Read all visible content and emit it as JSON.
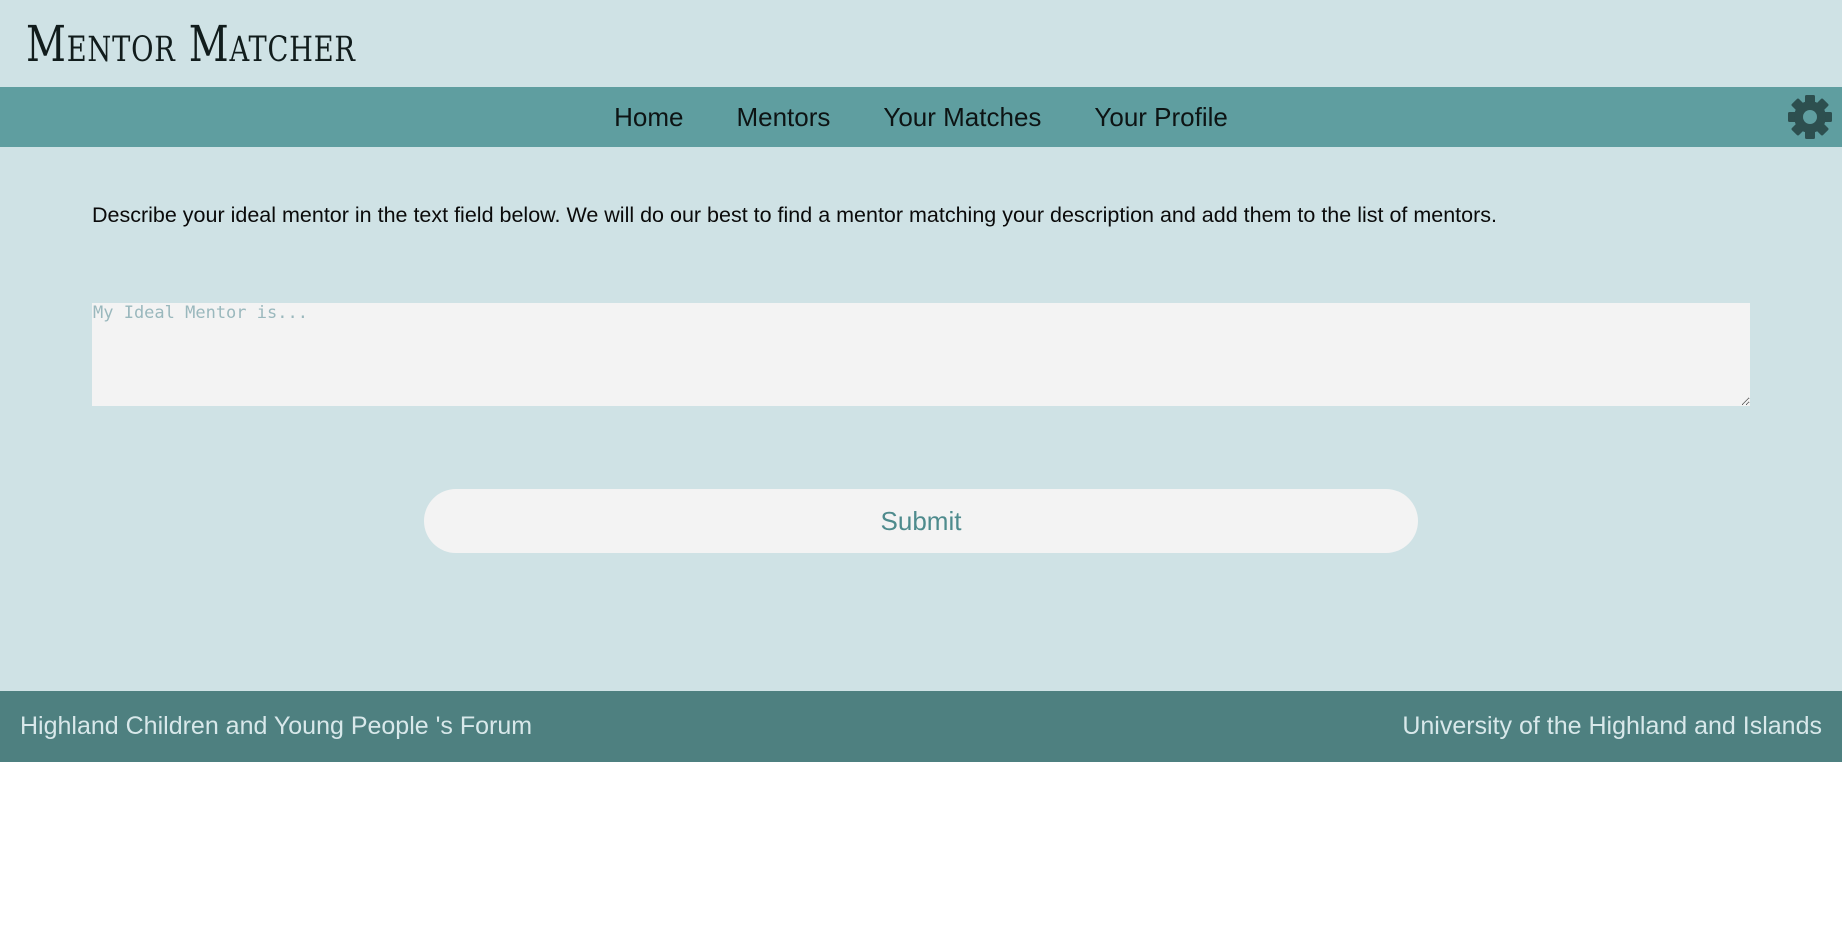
{
  "app": {
    "title": "Mentor Matcher"
  },
  "nav": {
    "items": [
      {
        "label": "Home"
      },
      {
        "label": "Mentors"
      },
      {
        "label": "Your Matches"
      },
      {
        "label": "Your Profile"
      }
    ],
    "settings_icon": "gear-icon"
  },
  "main": {
    "intro": "Describe your ideal mentor in the text field below. We will do our best to find a mentor matching your description and add them to the list of mentors.",
    "input": {
      "placeholder": "My Ideal Mentor is...",
      "value": ""
    },
    "submit_label": "Submit"
  },
  "footer": {
    "left": "Highland Children and Young People 's Forum",
    "right": "University of the Highland and Islands"
  },
  "colors": {
    "page_bg": "#cfe2e5",
    "nav_bg": "#5f9ea0",
    "footer_bg": "#4e8080",
    "accent_text": "#4e8b8d",
    "icon": "#2d4f4f"
  }
}
